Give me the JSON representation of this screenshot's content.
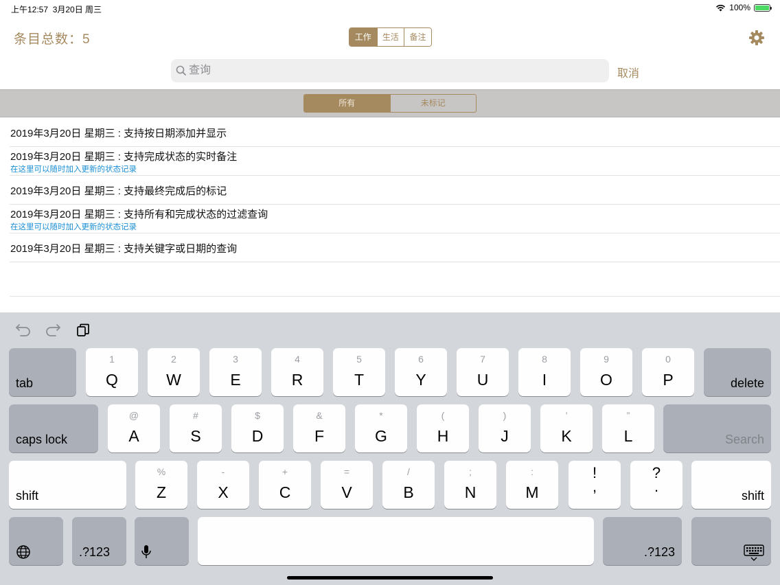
{
  "status": {
    "time": "上午12:57",
    "date": "3月20日 周三",
    "battery": "100%"
  },
  "header": {
    "count_label": "条目总数：5",
    "tabs": [
      "工作",
      "生活",
      "备注"
    ],
    "active_tab": "工作",
    "settings_icon": "gear-icon"
  },
  "search": {
    "placeholder": "查询",
    "value": "",
    "cancel_label": "取消"
  },
  "filter": {
    "options": [
      "所有",
      "未标记"
    ],
    "selected": "所有"
  },
  "items": [
    {
      "title": "2019年3月20日 星期三 : 支持按日期添加并显示",
      "note": ""
    },
    {
      "title": "2019年3月20日 星期三 : 支持完成状态的实时备注",
      "note": "在这里可以随时加入更新的状态记录"
    },
    {
      "title": "2019年3月20日 星期三 : 支持最终完成后的标记",
      "note": ""
    },
    {
      "title": "2019年3月20日 星期三 : 支持所有和完成状态的过滤查询",
      "note": "在这里可以随时加入更新的状态记录"
    },
    {
      "title": "2019年3月20日 星期三 : 支持关键字或日期的查询",
      "note": ""
    }
  ],
  "keyboard": {
    "row1": [
      [
        "1",
        "Q"
      ],
      [
        "2",
        "W"
      ],
      [
        "3",
        "E"
      ],
      [
        "4",
        "R"
      ],
      [
        "5",
        "T"
      ],
      [
        "6",
        "Y"
      ],
      [
        "7",
        "U"
      ],
      [
        "8",
        "I"
      ],
      [
        "9",
        "O"
      ],
      [
        "0",
        "P"
      ]
    ],
    "row2": [
      [
        "@",
        "A"
      ],
      [
        "#",
        "S"
      ],
      [
        "$",
        "D"
      ],
      [
        "&",
        "F"
      ],
      [
        "*",
        "G"
      ],
      [
        "(",
        "H"
      ],
      [
        ")",
        "J"
      ],
      [
        "’",
        "K"
      ],
      [
        "”",
        "L"
      ]
    ],
    "row3": [
      [
        "%",
        "Z"
      ],
      [
        "-",
        "X"
      ],
      [
        "+",
        "C"
      ],
      [
        "=",
        "V"
      ],
      [
        "/",
        "B"
      ],
      [
        ";",
        "N"
      ],
      [
        ":",
        "M"
      ]
    ],
    "row3_punct": [
      [
        "!",
        ","
      ],
      [
        "?",
        "."
      ]
    ],
    "tab": "tab",
    "delete": "delete",
    "caps_lock": "caps lock",
    "search": "Search",
    "shift": "shift",
    "num": ".?123"
  },
  "colors": {
    "accent": "#a68a5f",
    "note": "#1e90d6"
  }
}
